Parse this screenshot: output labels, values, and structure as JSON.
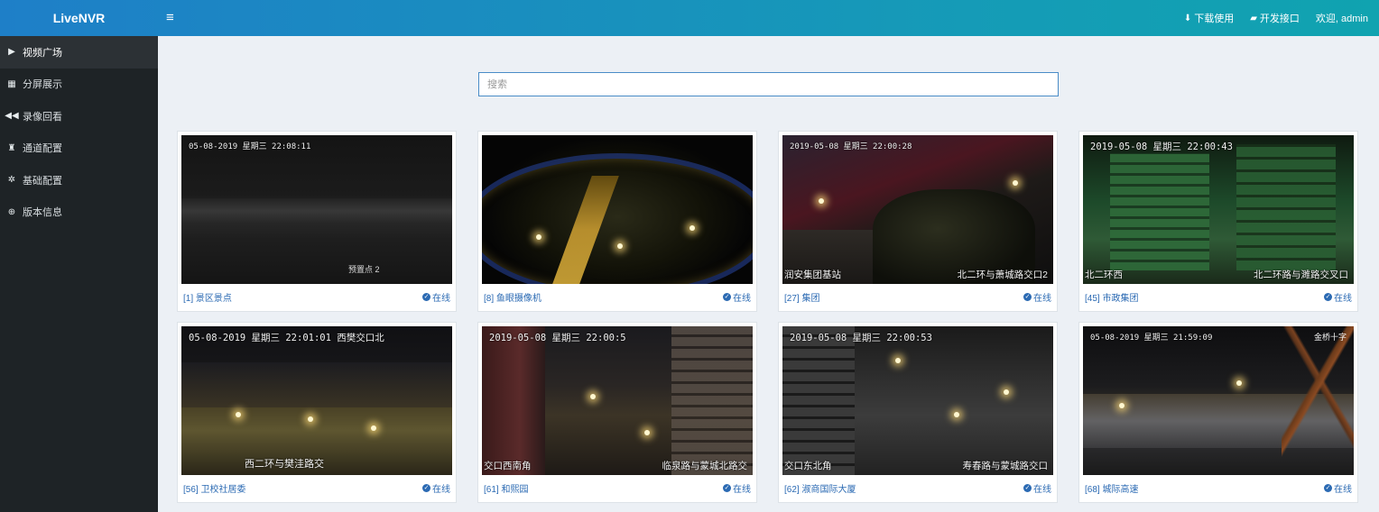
{
  "app": {
    "logo": "LiveNVR",
    "menu_toggle_icon": "hamburger-icon"
  },
  "topbar": {
    "links": [
      {
        "icon": "download-icon",
        "glyph": "⬇",
        "label": "下载使用"
      },
      {
        "icon": "book-icon",
        "glyph": "▰",
        "label": "开发接口"
      }
    ],
    "user": "欢迎, admin"
  },
  "sidebar": {
    "items": [
      {
        "icon": "play-icon",
        "glyph": "▶",
        "label": "视频广场",
        "active": true
      },
      {
        "icon": "grid-icon",
        "glyph": "▦",
        "label": "分屏展示",
        "active": false
      },
      {
        "icon": "rewind-icon",
        "glyph": "◀◀",
        "label": "录像回看",
        "active": false
      },
      {
        "icon": "sitemap-icon",
        "glyph": "♜",
        "label": "通道配置",
        "active": false
      },
      {
        "icon": "gear-icon",
        "glyph": "✲",
        "label": "基础配置",
        "active": false
      },
      {
        "icon": "globe-icon",
        "glyph": "⊕",
        "label": "版本信息",
        "active": false
      }
    ]
  },
  "search": {
    "placeholder": "搜索",
    "value": ""
  },
  "status_label": "在线",
  "cameras": [
    {
      "name": "[1] 景区景点",
      "osd_time": "05-08-2019 星期三 22:08:11",
      "osd_extra": "预置点 2"
    },
    {
      "name": "[8] 鱼眼摄像机",
      "osd_time": ""
    },
    {
      "name": "[27] 集团",
      "osd_time": "2019-05-08 星期三 22:00:28",
      "osd_left": "润安集团基站",
      "osd_right": "北二环与萧城路交口2"
    },
    {
      "name": "[45] 市政集团",
      "osd_time": "2019-05-08 星期三 22:00:43",
      "osd_left": "北二环西",
      "osd_right": "北二环路与濉路交叉口"
    },
    {
      "name": "[56] 卫校社居委",
      "osd_time": "05-08-2019 星期三 22:01:01 西樊交口北",
      "osd_bottom": "西二环与樊洼路交"
    },
    {
      "name": "[61] 和熙园",
      "osd_time": "2019-05-08 星期三 22:00:5",
      "osd_left": "交口西南角",
      "osd_right": "临泉路与蒙城北路交"
    },
    {
      "name": "[62] 淑商国际大厦",
      "osd_time": "2019-05-08 星期三 22:00:53",
      "osd_left": "交口东北角",
      "osd_right": "寿春路与蒙城路交口"
    },
    {
      "name": "[68] 城际高速",
      "osd_time": "05-08-2019 星期三 21:59:09",
      "osd_topright": "金桥十字"
    }
  ],
  "colors": {
    "topbar_start": "#1e7fc8",
    "topbar_end": "#10a3b0",
    "sidebar_bg": "#1e2326",
    "content_bg": "#ecf0f5",
    "link_blue": "#2b6ab3"
  }
}
